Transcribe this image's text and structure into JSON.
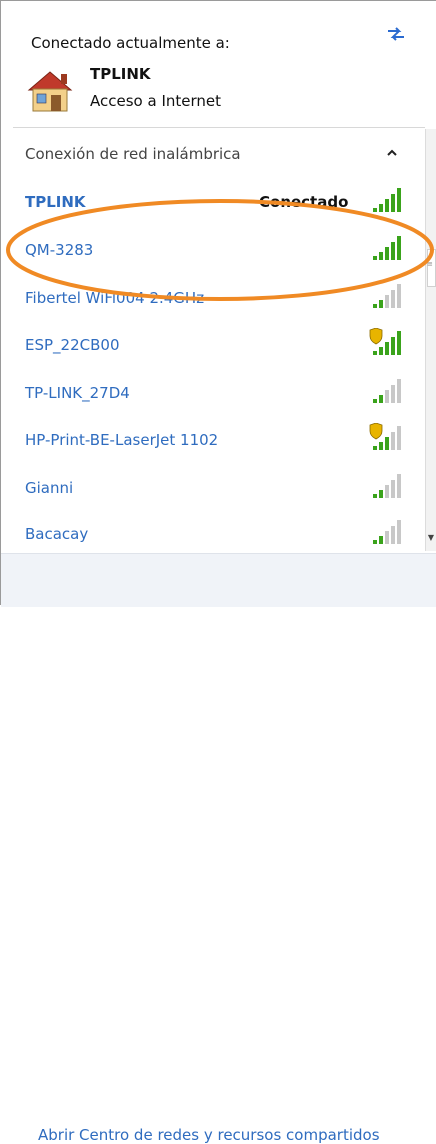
{
  "header": {
    "connected_label": "Conectado actualmente a:"
  },
  "current_network": {
    "name": "TPLINK",
    "status": "Acceso a Internet"
  },
  "section": {
    "title": "Conexión de red inalámbrica"
  },
  "networks": [
    {
      "name": "TPLINK",
      "status": "Conectado",
      "signal": 5,
      "secured": false,
      "bold": true
    },
    {
      "name": "QM-3283",
      "status": "",
      "signal": 5,
      "secured": false,
      "bold": false
    },
    {
      "name": "Fibertel WiFi004 2.4GHz",
      "status": "",
      "signal": 2,
      "secured": false,
      "bold": false
    },
    {
      "name": "ESP_22CB00",
      "status": "",
      "signal": 5,
      "secured": true,
      "bold": false
    },
    {
      "name": "TP-LINK_27D4",
      "status": "",
      "signal": 2,
      "secured": false,
      "bold": false
    },
    {
      "name": "HP-Print-BE-LaserJet 1102",
      "status": "",
      "signal": 3,
      "secured": true,
      "bold": false
    },
    {
      "name": "Gianni",
      "status": "",
      "signal": 2,
      "secured": false,
      "bold": false
    },
    {
      "name": "Bacacay",
      "status": "",
      "signal": 2,
      "secured": false,
      "bold": false
    }
  ],
  "footer": {
    "link": "Abrir Centro de redes y recursos compartidos"
  },
  "colors": {
    "link": "#2f6cbf",
    "signal_on": "#3aa31b",
    "signal_off": "#c8c8c8",
    "highlight": "#f08a24"
  }
}
